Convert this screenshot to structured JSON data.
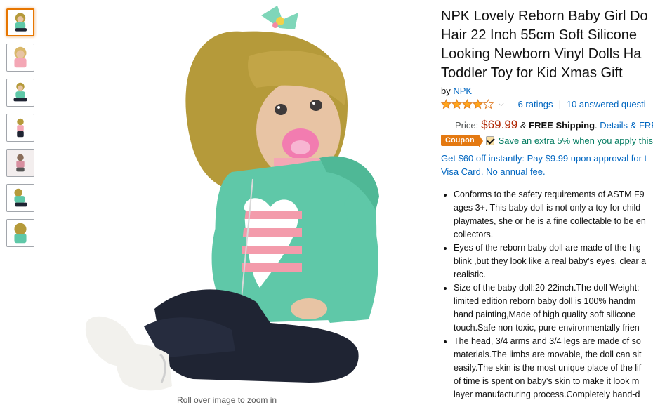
{
  "thumbnails": [
    {
      "name": "thumb-1",
      "selected": true
    },
    {
      "name": "thumb-2",
      "selected": false
    },
    {
      "name": "thumb-3",
      "selected": false
    },
    {
      "name": "thumb-4",
      "selected": false
    },
    {
      "name": "thumb-5",
      "selected": false
    },
    {
      "name": "thumb-6",
      "selected": false
    },
    {
      "name": "thumb-7",
      "selected": false
    }
  ],
  "zoom_hint": "Roll over image to zoom in",
  "product": {
    "title": "NPK Lovely Reborn Baby Girl Do\nHair 22 Inch 55cm Soft Silicone\nLooking Newborn Vinyl Dolls Ha\nToddler Toy for Kid Xmas Gift",
    "by_label": "by",
    "brand": "NPK",
    "rating_value": 4.0,
    "ratings_count": "6 ratings",
    "answered_questions": "10 answered questi",
    "price_label": "Price:",
    "price": "$69.99",
    "shipping_amp": "&",
    "shipping": "FREE Shipping",
    "shipping_dot": ".",
    "details_link": "Details",
    "free_trunc": "& FRE",
    "coupon_badge": "Coupon",
    "coupon_text": "Save an extra 5% when you apply this",
    "offer": "Get $60 off instantly: Pay $9.99 upon approval for t\nVisa Card. No annual fee.",
    "bullets": [
      "Conforms to the safety requirements of ASTM F9\nages 3+. This baby doll is not only a toy for child\nplaymates, she or he is a fine collectable to be en\ncollectors.",
      "Eyes of the reborn baby doll are made of the hig\nblink ,but they look like a real baby's eyes, clear a\nrealistic.",
      "Size of the baby doll:20-22inch.The doll Weight:\nlimited edition reborn baby doll is 100% handm\nhand painting,Made of high quality soft silicone\ntouch.Safe non-toxic, pure environmentally frien",
      "The head, 3/4 arms and 3/4 legs are made of so\nmaterials.The limbs are movable, the doll can sit\neasily.The skin is the most unique place of the lif\nof time is spent on baby's skin to make it look m\nlayer manufacturing process.Completely hand-d"
    ]
  },
  "colors": {
    "link": "#0066c0",
    "price": "#b12704",
    "coupon": "#e47911",
    "coupon_text": "#067d62",
    "star": "#ffa41c",
    "hoodie": "#5fc8a8",
    "hair": "#b59a3a",
    "jeans": "#1f2433"
  }
}
